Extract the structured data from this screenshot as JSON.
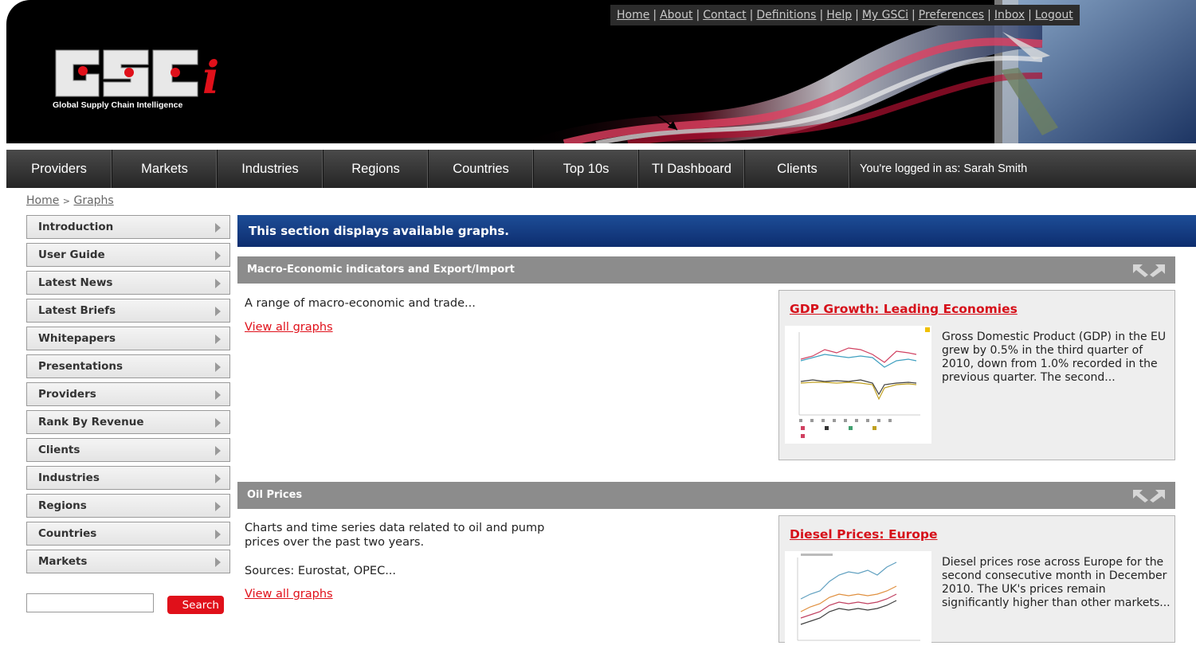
{
  "banner": {
    "logo_letters": "GSCi",
    "logo_tagline": "Global Supply Chain Intelligence"
  },
  "top_links": [
    "Home",
    "About",
    "Contact",
    "Definitions",
    "Help",
    "My GSCi",
    "Preferences",
    "Inbox",
    "Logout"
  ],
  "main_nav": {
    "items": [
      "Providers",
      "Markets",
      "Industries",
      "Regions",
      "Countries",
      "Top 10s",
      "TI Dashboard",
      "Clients"
    ],
    "login_status": "You're logged in as: Sarah Smith"
  },
  "breadcrumb": {
    "home": "Home",
    "separator": ">",
    "current": "Graphs"
  },
  "sidebar": {
    "items": [
      "Introduction",
      "User Guide",
      "Latest News",
      "Latest Briefs",
      "Whitepapers",
      "Presentations",
      "Providers",
      "Rank By Revenue",
      "Clients",
      "Industries",
      "Regions",
      "Countries",
      "Markets"
    ],
    "search_button": "Search",
    "search_value": ""
  },
  "main": {
    "section_title": "This section displays available graphs.",
    "categories": [
      {
        "title": "Macro-Economic indicators and Export/Import",
        "description_lines": [
          "A range of macro-economic and trade..."
        ],
        "sources": "",
        "view_all": "View all graphs",
        "feature": {
          "title": "GDP Growth: Leading Economies",
          "text": "Gross Domestic Product (GDP) in the EU grew by 0.5% in the third quarter of 2010, down from 1.0% recorded in the previous quarter. The second..."
        }
      },
      {
        "title": "Oil Prices",
        "description_lines": [
          "Charts and time series data related to oil and pump",
          "prices over the past two years."
        ],
        "sources": "Sources: Eurostat, OPEC...",
        "view_all": "View all graphs",
        "feature": {
          "title": "Diesel Prices: Europe",
          "text": "Diesel prices rose across Europe for the second consecutive month in December 2010. The UK's prices remain significantly higher than other markets..."
        }
      }
    ]
  },
  "colors": {
    "accent_red": "#e0101a",
    "section_blue": "#1d4d97",
    "category_gray": "#8c8c8c",
    "nav_dark": "#333333"
  }
}
